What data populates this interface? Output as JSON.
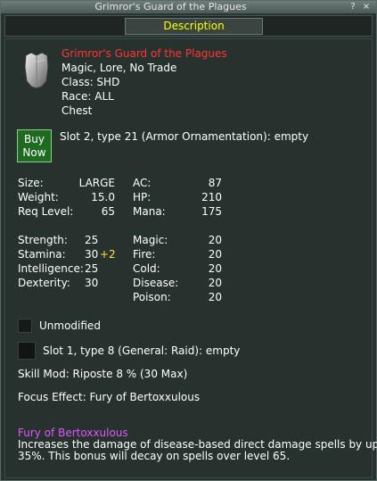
{
  "window": {
    "title": "Grimror's Guard of the Plagues",
    "help_glyph": "?",
    "close_glyph": "×"
  },
  "tab": {
    "label": "Description"
  },
  "item": {
    "name": "Grimror's Guard of the Plagues",
    "flags": "Magic, Lore, No Trade",
    "class_line": "Class: SHD",
    "race_line": "Race: ALL",
    "slot_line": "Chest",
    "icon": "chest-armor-icon"
  },
  "buy_button": {
    "line1": "Buy",
    "line2": "Now"
  },
  "ornament_slot": "Slot 2, type 21 (Armor Ornamentation): empty",
  "stats_top": [
    {
      "label": "Size:",
      "value": "LARGE",
      "label2": "AC:",
      "value2": "87"
    },
    {
      "label": "Weight:",
      "value": "15.0",
      "label2": "HP:",
      "value2": "210"
    },
    {
      "label": "Req Level:",
      "value": "65",
      "label2": "Mana:",
      "value2": "175"
    }
  ],
  "stats_attr": [
    {
      "label": "Strength:",
      "value": "25",
      "bonus": "",
      "label2": "Magic:",
      "value2": "20"
    },
    {
      "label": "Stamina:",
      "value": "30",
      "bonus": "+2",
      "label2": "Fire:",
      "value2": "20"
    },
    {
      "label": "Intelligence:",
      "value": "25",
      "bonus": "",
      "label2": "Cold:",
      "value2": "20"
    },
    {
      "label": "Dexterity:",
      "value": "30",
      "bonus": "",
      "label2": "Disease:",
      "value2": "20"
    },
    {
      "label": "",
      "value": "",
      "bonus": "",
      "label2": "Poison:",
      "value2": "20"
    }
  ],
  "unmodified_label": "Unmodified",
  "raid_slot": "Slot 1, type 8 (General: Raid): empty",
  "skill_mod": "Skill Mod: Riposte 8 % (30 Max)",
  "focus_effect": "Focus Effect: Fury of Bertoxxulous",
  "focus_desc": {
    "name": "Fury of Bertoxxulous",
    "line1": "Increases the damage of disease-based direct damage spells by up to",
    "line2": "35%. This bonus will decay on spells over level 65."
  },
  "colors": {
    "item_name": "#ff3434",
    "bonus": "#ffe23a",
    "focus_name": "#e055ff",
    "tab_text": "#ffff00",
    "buy_bg": "#1f6a21"
  }
}
